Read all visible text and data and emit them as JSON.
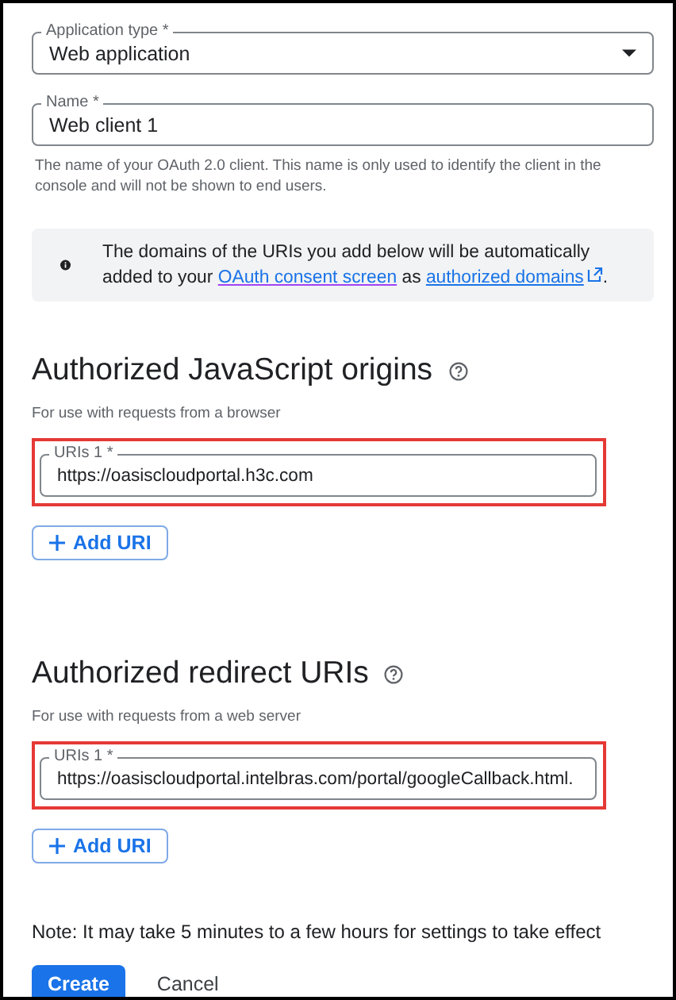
{
  "application_type": {
    "label": "Application type *",
    "value": "Web application"
  },
  "name": {
    "label": "Name *",
    "value": "Web client 1",
    "helper": "The name of your OAuth 2.0 client. This name is only used to identify the client in the console and will not be shown to end users."
  },
  "info": {
    "text_before": "The domains of the URIs you add below will be automatically added to your",
    "link_1": "OAuth consent screen",
    "text_middle": "as",
    "link_2": "authorized domains",
    "text_end": "."
  },
  "sections": [
    {
      "heading": "Authorized JavaScript origins",
      "subtitle": "For use with requests from a browser",
      "uris": [
        {
          "label": "URIs 1 *",
          "value": "https://oasiscloudportal.h3c.com",
          "highlighted": true
        }
      ],
      "add_button": "Add URI"
    },
    {
      "heading": "Authorized redirect URIs",
      "subtitle": "For use with requests from a web server",
      "uris": [
        {
          "label": "URIs 1 *",
          "value": "https://oasiscloudportal.intelbras.com/portal/googleCallback.html.",
          "highlighted": true
        }
      ],
      "add_button": "Add URI"
    }
  ],
  "note": "Note: It may take 5 minutes to a few hours for settings to take effect",
  "buttons": [
    {
      "label": "Create",
      "kind": "primary"
    },
    {
      "label": "Cancel",
      "kind": "text"
    }
  ]
}
